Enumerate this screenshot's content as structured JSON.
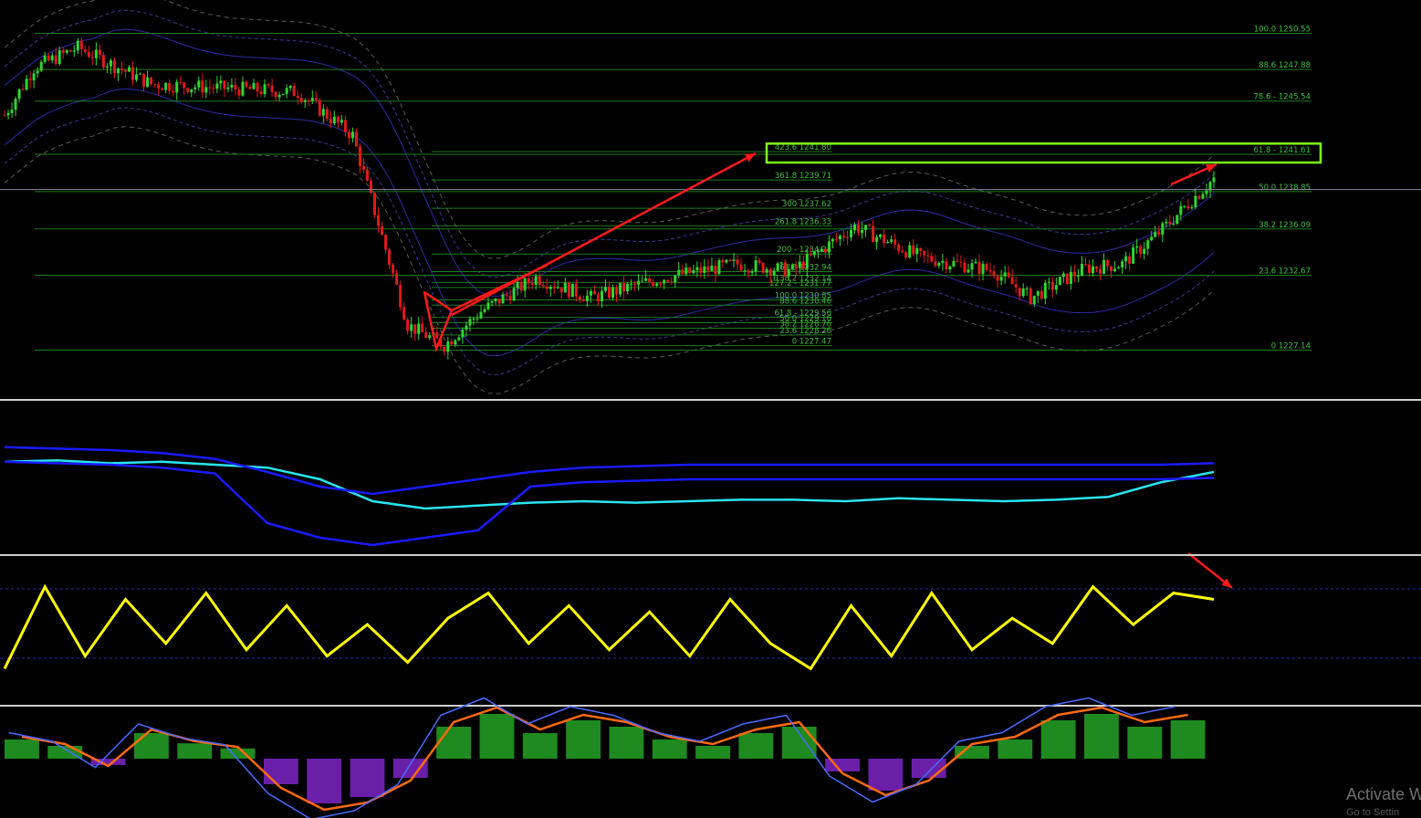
{
  "colors": {
    "background": "#000000",
    "bull_candle": "#2fd72f",
    "bear_candle": "#e01a1a",
    "fib_line": "#1f7a1f",
    "fib_text": "#3fbf3f",
    "channel": "#2c2ca8",
    "arrow": "#ff1a1a",
    "highlight_box": "#7dff1a",
    "rsi_line": "#ffff00",
    "cyan_line": "#29e5f0",
    "band_blue": "#1a1aff",
    "macd_pos": "#1f8a1f",
    "macd_neg": "#6a1fa8",
    "stoch_orange": "#ff6a10",
    "stoch_blue": "#4a6aff"
  },
  "watermark": {
    "activate_text": "Activate W",
    "goto_text": "Go to Settin"
  },
  "chart_data": [
    {
      "type": "line",
      "panel": "price",
      "description_source": "candlestick price panel with fibonacci levels",
      "x_index_range": [
        0,
        330
      ],
      "ylim": [
        1224.0,
        1252.0
      ],
      "close_path": [
        [
          0,
          1244.5
        ],
        [
          8,
          1248.0
        ],
        [
          20,
          1249.5
        ],
        [
          40,
          1246.8
        ],
        [
          60,
          1246.5
        ],
        [
          80,
          1246.2
        ],
        [
          95,
          1243.0
        ],
        [
          110,
          1229.0
        ],
        [
          120,
          1227.5
        ],
        [
          130,
          1230.0
        ],
        [
          145,
          1232.5
        ],
        [
          160,
          1231.0
        ],
        [
          180,
          1232.5
        ],
        [
          200,
          1233.5
        ],
        [
          215,
          1233.0
        ],
        [
          232,
          1236.3
        ],
        [
          250,
          1234.0
        ],
        [
          270,
          1233.0
        ],
        [
          280,
          1231.0
        ],
        [
          295,
          1233.2
        ],
        [
          305,
          1233.5
        ],
        [
          315,
          1235.8
        ],
        [
          325,
          1238.5
        ],
        [
          330,
          1239.8
        ]
      ],
      "right_fib_levels": [
        {
          "label": "100.0 1250.55",
          "value": 1250.55
        },
        {
          "label": "88.6 1247.88",
          "value": 1247.88
        },
        {
          "label": "78.6 - 1245.54",
          "value": 1245.54
        },
        {
          "label": "61.8 - 1241.61",
          "value": 1241.61
        },
        {
          "label": "50.0 1238.85",
          "value": 1238.85
        },
        {
          "label": "38.2 1236.09",
          "value": 1236.09
        },
        {
          "label": "23.6 1232.67",
          "value": 1232.67
        },
        {
          "label": "0 1227.14",
          "value": 1227.14
        }
      ],
      "left_fib_levels": [
        {
          "label": "423.6 1241.80",
          "value": 1241.8
        },
        {
          "label": "361.8 1239.71",
          "value": 1239.71
        },
        {
          "label": "300 1237.62",
          "value": 1237.62
        },
        {
          "label": "261.8 1236.33",
          "value": 1236.33
        },
        {
          "label": "200 - 1234.24",
          "value": 1234.24
        },
        {
          "label": "161.8 1232.94",
          "value": 1232.94
        },
        {
          "label": "138.2 1232.14",
          "value": 1232.14
        },
        {
          "label": "127.2 - 1231.77",
          "value": 1231.77
        },
        {
          "label": "100.0 1230.85",
          "value": 1230.85
        },
        {
          "label": "88.6 1230.46",
          "value": 1230.46
        },
        {
          "label": "61.8 - 1229.56",
          "value": 1229.56
        },
        {
          "label": "50.0 1229.16",
          "value": 1229.16
        },
        {
          "label": "38.2 1228.76",
          "value": 1228.76
        },
        {
          "label": "23.6 1228.26",
          "value": 1228.26
        },
        {
          "label": "0 1227.47",
          "value": 1227.47
        }
      ],
      "highlight_box_range": [
        1241.0,
        1242.4
      ],
      "current_price_line": 1239.0
    },
    {
      "type": "line",
      "panel": "oscillator-1",
      "series": [
        {
          "name": "",
          "color": "#29e5f0",
          "values": [
            62,
            63,
            61,
            62,
            60,
            58,
            50,
            35,
            30,
            32,
            34,
            35,
            34,
            35,
            36,
            36,
            35,
            37,
            36,
            35,
            36,
            38,
            48,
            55
          ]
        },
        {
          "name": "",
          "color": "#1a1aff",
          "values": [
            72,
            71,
            70,
            68,
            64,
            55,
            45,
            40,
            45,
            50,
            55,
            58,
            59,
            60,
            60,
            60,
            60,
            60,
            60,
            60,
            60,
            60,
            60,
            61
          ]
        }
      ]
    },
    {
      "type": "line",
      "panel": "oscillator-2",
      "series": [
        {
          "name": "",
          "color": "#ffff00",
          "values": [
            20,
            85,
            30,
            75,
            40,
            80,
            35,
            70,
            30,
            55,
            25,
            60,
            80,
            40,
            70,
            35,
            65,
            30,
            75,
            40,
            20,
            70,
            30,
            80,
            35,
            60,
            40,
            85,
            55,
            80,
            75
          ]
        }
      ]
    },
    {
      "type": "bar",
      "panel": "oscillator-3",
      "series": [
        {
          "name": "",
          "color": "#1f8a1f",
          "values": [
            15,
            10,
            -5,
            20,
            12,
            8,
            -20,
            -35,
            -30,
            -15,
            25,
            35,
            20,
            30,
            25,
            15,
            10,
            20,
            25,
            -10,
            -25,
            -15,
            10,
            15,
            30,
            35,
            25,
            30
          ]
        }
      ]
    }
  ]
}
